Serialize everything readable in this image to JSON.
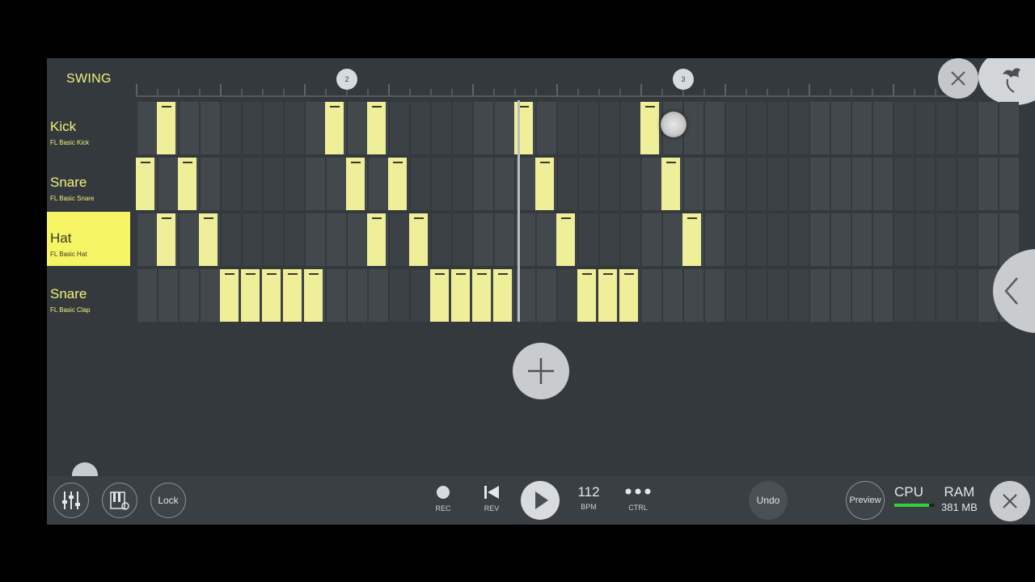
{
  "swing_label": "SWING",
  "bar_markers": [
    "2",
    "3"
  ],
  "channels": [
    {
      "name": "Kick",
      "sample": "FL Basic Kick",
      "selected": false,
      "steps": [
        1,
        9,
        11,
        18,
        24
      ]
    },
    {
      "name": "Snare",
      "sample": "FL Basic Snare",
      "selected": false,
      "steps": [
        0,
        2,
        10,
        12,
        19,
        25
      ]
    },
    {
      "name": "Hat",
      "sample": "FL Basic Hat",
      "selected": true,
      "steps": [
        1,
        3,
        11,
        13,
        20,
        26
      ]
    },
    {
      "name": "Snare",
      "sample": "FL Basic Clap",
      "selected": false,
      "steps": [
        4,
        5,
        6,
        7,
        8,
        14,
        15,
        16,
        17,
        21,
        22,
        23
      ]
    }
  ],
  "toolbar": {
    "lock_label": "Lock",
    "rec_label": "REC",
    "rev_label": "REV",
    "bpm_value": "112",
    "bpm_label": "BPM",
    "ctrl_label": "CTRL",
    "undo_label": "Undo",
    "preview_label": "Preview",
    "cpu_label": "CPU",
    "cpu_level": 0.85,
    "ram_label": "RAM",
    "ram_value": "381 MB"
  },
  "colors": {
    "step_on": "#efef9a",
    "accent_yellow": "#f4f464",
    "cpu_green": "#34d13a"
  },
  "icons": [
    "mixer-icon",
    "piano-settings-icon",
    "record-icon",
    "rewind-icon",
    "play-icon",
    "more-dots-icon",
    "close-icon",
    "add-icon",
    "chevron-left-icon",
    "fruit-logo-icon"
  ]
}
